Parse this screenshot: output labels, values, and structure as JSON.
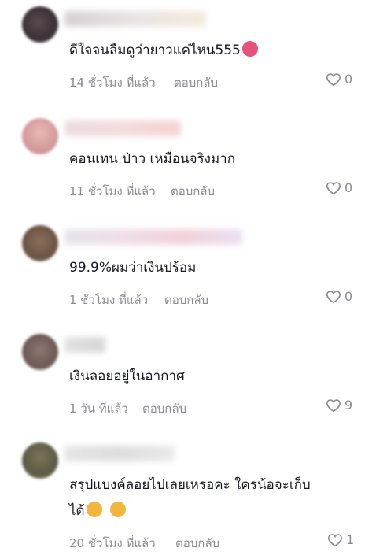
{
  "comments": [
    {
      "text": "ดีใจจนลืมดูว่ายาวแค่ไหน555",
      "time": "14 ชั่วโมง ที่แล้ว",
      "reply": "ตอบกลับ",
      "likes": "0",
      "emoji": "laughing-face"
    },
    {
      "text": "คอนเทน ป่าว เหมือนจริงมาก",
      "time": "11 ชั่วโมง ที่แล้ว",
      "reply": "ตอบกลับ",
      "likes": "0"
    },
    {
      "text": "99.9%ผมว่าเงินปร้อม",
      "time": "1 ชั่วโมง ที่แล้ว",
      "reply": "ตอบกลับ",
      "likes": "0"
    },
    {
      "text": "เงินลอยอยู่ในอากาศ",
      "time": "1 วัน ที่แล้ว",
      "reply": "ตอบกลับ",
      "likes": "9"
    },
    {
      "text_line1": "สรุปแบงค์ลอยไปเลยเหรอคะ ใครน้อจะเก็บ",
      "text_line2": "ได้",
      "time": "20 ชั่วโมง ที่แล้ว",
      "reply": "ตอบกลับ",
      "likes": "1",
      "emoji": "grinning-face"
    }
  ],
  "colors": {
    "text": "#161823",
    "meta": "#8a8b91",
    "emoji": "#f2b63c"
  },
  "icons": {
    "like": "heart-outline-icon"
  }
}
